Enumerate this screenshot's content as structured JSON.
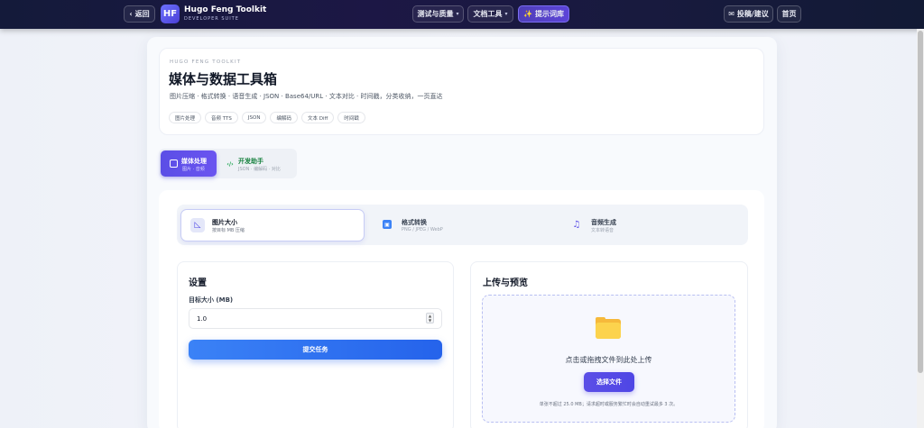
{
  "header": {
    "back_label": "返回",
    "logo_text": "HF",
    "brand_title": "Hugo Feng Toolkit",
    "brand_subtitle": "DEVELOPER SUITE",
    "nav": {
      "test_quality": "测试与质量",
      "doc_tools": "文档工具",
      "prompt_library": "提示词库"
    },
    "feedback_label": "投稿/建议",
    "home_label": "首页"
  },
  "hero": {
    "kicker": "HUGO FENG TOOLKIT",
    "title": "媒体与数据工具箱",
    "description": "图片压缩 · 格式转换 · 语音生成 · JSON · Base64/URL · 文本对比 · 时间戳，分类收纳，一页直达",
    "tags": [
      "图片处理",
      "音频 TTS",
      "JSON",
      "编解码",
      "文本 Diff",
      "时间戳"
    ]
  },
  "categories": {
    "media": {
      "title": "媒体处理",
      "subtitle": "图片 · 音频"
    },
    "dev": {
      "title": "开发助手",
      "subtitle": "JSON · 编解码 · 对比"
    }
  },
  "subtabs": [
    {
      "title": "图片大小",
      "subtitle": "按目标 MB 压缩"
    },
    {
      "title": "格式转换",
      "subtitle": "PNG / JPEG / WebP"
    },
    {
      "title": "音频生成",
      "subtitle": "文本转语音"
    }
  ],
  "settings": {
    "title": "设置",
    "target_label": "目标大小 (MB)",
    "target_value": "1.0",
    "submit_label": "提交任务"
  },
  "upload": {
    "title": "上传与预览",
    "drop_text": "点击或拖拽文件到此处上传",
    "choose_label": "选择文件",
    "note": "单张不超过 25.0 MB；请求超时或服务繁忙时会自动重试最多 3 次。"
  },
  "colors": {
    "accent": "#5b4ee6",
    "primary_button": "#3b82f6",
    "topbar": "#1a1740"
  },
  "icons": {
    "back": "chevron-left-icon",
    "prompt": "sparkle-icon",
    "feedback": "mail-icon",
    "media_category": "image-icon",
    "dev_category": "code-icon",
    "image_size": "ruler-icon",
    "format": "image-format-icon",
    "audio": "music-note-icon",
    "upload": "folder-icon"
  }
}
